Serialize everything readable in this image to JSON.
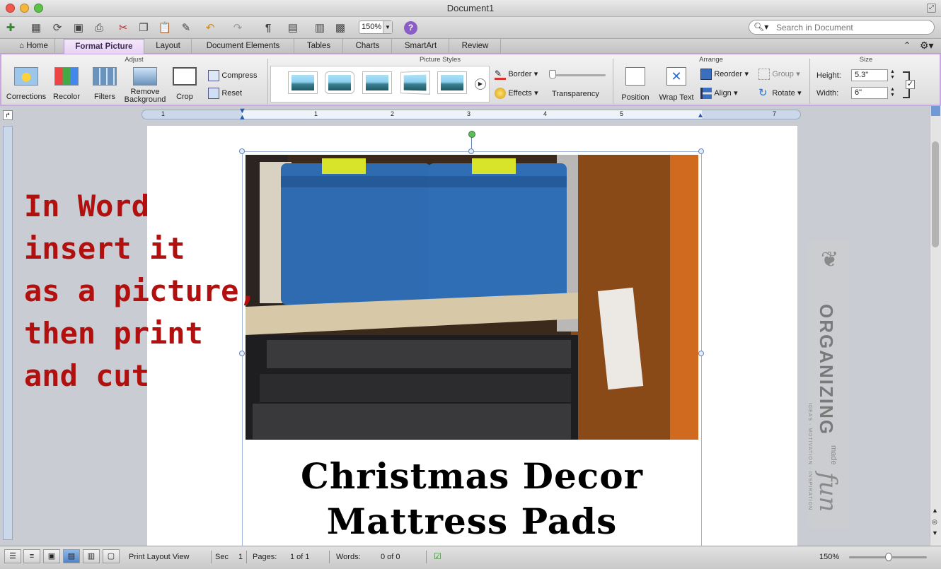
{
  "window": {
    "title": "Document1"
  },
  "toolbar": {
    "zoom": "150%",
    "search_placeholder": "Search in Document"
  },
  "tabs": [
    {
      "label": "Home"
    },
    {
      "label": "Format Picture",
      "active": true
    },
    {
      "label": "Layout"
    },
    {
      "label": "Document Elements"
    },
    {
      "label": "Tables"
    },
    {
      "label": "Charts"
    },
    {
      "label": "SmartArt"
    },
    {
      "label": "Review"
    }
  ],
  "ribbon": {
    "groups": {
      "adjust": "Adjust",
      "picture_styles": "Picture Styles",
      "arrange": "Arrange",
      "size": "Size"
    },
    "adjust": {
      "corrections": "Corrections",
      "recolor": "Recolor",
      "filters": "Filters",
      "remove_background_1": "Remove",
      "remove_background_2": "Background",
      "crop": "Crop",
      "compress": "Compress",
      "reset": "Reset"
    },
    "styles": {
      "border": "Border",
      "effects": "Effects",
      "transparency": "Transparency"
    },
    "arrange": {
      "position": "Position",
      "wrap_text": "Wrap Text",
      "reorder": "Reorder",
      "align": "Align",
      "group": "Group",
      "rotate": "Rotate"
    },
    "size": {
      "height_label": "Height:",
      "height_value": "5.3\"",
      "width_label": "Width:",
      "width_value": "6\""
    }
  },
  "ruler": {
    "labels": [
      "1",
      "1",
      "2",
      "3",
      "4",
      "5",
      "7"
    ]
  },
  "document": {
    "overlay_lines": [
      "In Word",
      "insert it",
      "as a picture,",
      "then print",
      "and cut"
    ],
    "caption_line1": "Christmas Decor",
    "caption_line2": "Mattress Pads",
    "watermark_brand": "ORGANIZING",
    "watermark_sub": "IDEAS · MOTIVATION · INSPIRATION",
    "watermark_made": "made",
    "watermark_fun": "fun"
  },
  "status": {
    "view": "Print Layout View",
    "sec_label": "Sec",
    "sec_value": "1",
    "pages_label": "Pages:",
    "pages_value": "1 of 1",
    "words_label": "Words:",
    "words_value": "0 of 0",
    "zoom": "150%"
  },
  "colors": {
    "accent": "#c9a7e0",
    "overlay_text": "#b20f0f"
  }
}
